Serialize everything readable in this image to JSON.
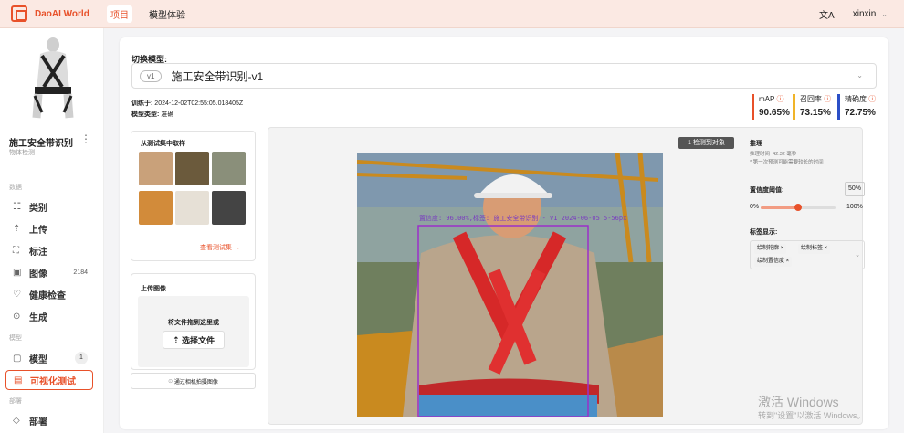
{
  "topbar": {
    "brand": "DaoAI World",
    "nav": [
      "项目",
      "模型体验"
    ],
    "lang_icon": "文A",
    "user": "xinxin",
    "user_caret": "⌄"
  },
  "sidebar": {
    "model_name": "施工安全带识别",
    "model_type": "物体检测",
    "more": "⋮",
    "sections": {
      "data": "数据",
      "model": "模型",
      "deploy": "部署"
    },
    "items": [
      {
        "label": "类别",
        "icon": "list-icon",
        "glyph": "☷"
      },
      {
        "label": "上传",
        "icon": "upload-icon",
        "glyph": "⇡"
      },
      {
        "label": "标注",
        "icon": "annotate-icon",
        "glyph": "⛶"
      },
      {
        "label": "图像",
        "icon": "image-icon",
        "glyph": "▣",
        "count": "2184"
      },
      {
        "label": "健康检查",
        "icon": "health-icon",
        "glyph": "♡"
      },
      {
        "label": "生成",
        "icon": "generate-icon",
        "glyph": "⊙"
      },
      {
        "label": "模型",
        "icon": "folder-icon",
        "glyph": "▢",
        "count": "1"
      },
      {
        "label": "可视化测试",
        "icon": "test-icon",
        "glyph": "▤"
      },
      {
        "label": "部署",
        "icon": "tag-icon",
        "glyph": "◇"
      }
    ]
  },
  "main": {
    "switch_title": "切换模型:",
    "version_tag": "v1",
    "selected_model": "施工安全带识别-v1",
    "select_caret": "⌄",
    "trained_label": "训练于:",
    "trained_value": "2024-12-02T02:55:05.018405Z",
    "type_label": "模型类型:",
    "type_value": "准确",
    "metrics": [
      {
        "label": "mAP",
        "value": "90.65%",
        "color": "#e8512a"
      },
      {
        "label": "召回率",
        "value": "73.15%",
        "color": "#f0b429"
      },
      {
        "label": "精确度",
        "value": "72.75%",
        "color": "#2b4fc7"
      }
    ],
    "info_icon": "ⓘ"
  },
  "samples": {
    "title": "从测试集中取样",
    "view_more": "查看测试集 →",
    "thumb_colors": [
      "#c9a17a",
      "#6b5a3c",
      "#8a8f7a",
      "#d28b3a",
      "#e6e0d6",
      "#444444"
    ]
  },
  "upload": {
    "title": "上传图像",
    "drop_text": "将文件拖到这里或",
    "choose_label": "选择文件",
    "upload_glyph": "⇡",
    "camera_label": "通过相机拍摄图像",
    "camera_glyph": "⊙"
  },
  "viewer": {
    "detect_count": "1 检测到对象",
    "detection_text": "置信度: 96.00%,标签: 施工安全带识别 - v1 2024-06-05 5-56px"
  },
  "panel": {
    "infer_title": "推理",
    "infer_time_label": "推理时间",
    "infer_time_value": "42.32 毫秒",
    "infer_note": "* 第一次预测可能需要较长的时间",
    "threshold_title": "置信度阈值:",
    "threshold_value": "50%",
    "threshold_fraction": 0.5,
    "min": "0%",
    "max": "100%",
    "tags_title": "标签显示:",
    "chips": [
      "绘制轮廓 ×",
      "绘制标签 ×",
      "绘制置信度 ×"
    ],
    "caret": "⌄"
  },
  "watermark": {
    "line1": "激活 Windows",
    "line2": "转到\"设置\"以激活 Windows。"
  }
}
